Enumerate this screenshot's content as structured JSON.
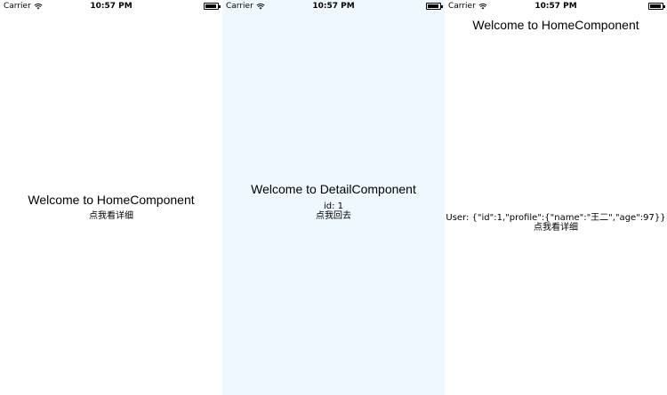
{
  "status_bar": {
    "carrier": "Carrier",
    "time": "10:57 PM",
    "battery_level": 0.9
  },
  "screens": [
    {
      "background": "#ffffff",
      "title": "Welcome to HomeComponent",
      "link": "点我看详细"
    },
    {
      "background": "#f0f8ff",
      "title": "Welcome to DetailComponent",
      "id_text": "id: 1",
      "link": "点我回去"
    },
    {
      "background": "#ffffff",
      "title": "Welcome to HomeComponent",
      "user_text": "User: {\"id\":1,\"profile\":{\"name\":\"王二\",\"age\":97}}",
      "link": "点我看详细"
    }
  ]
}
